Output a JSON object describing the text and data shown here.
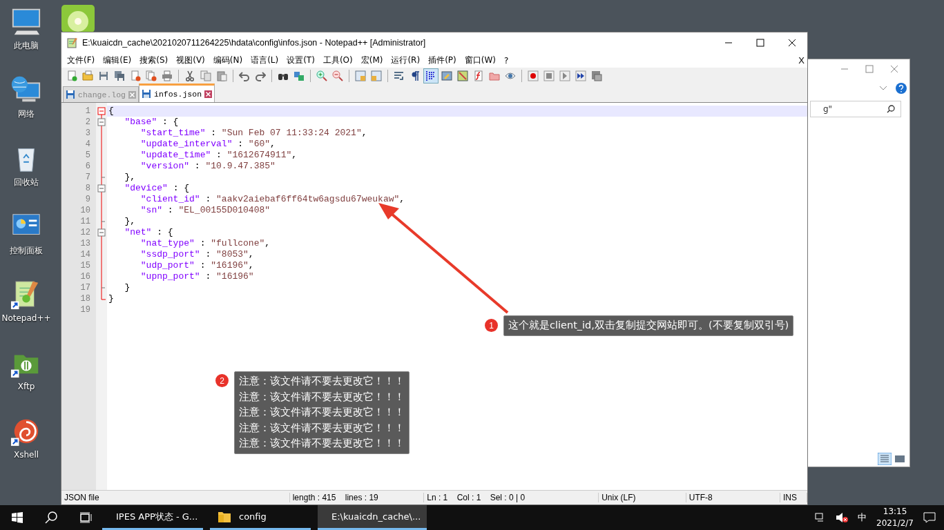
{
  "desktop_icons": [
    {
      "label": "此电脑",
      "kind": "computer",
      "shortcut": false
    },
    {
      "label": "网络",
      "kind": "network",
      "shortcut": false
    },
    {
      "label": "回收站",
      "kind": "recycle",
      "shortcut": false
    },
    {
      "label": "控制面板",
      "kind": "control",
      "shortcut": false
    },
    {
      "label": "Notepad++",
      "kind": "notepad",
      "shortcut": true
    },
    {
      "label": "Xftp",
      "kind": "xftp",
      "shortcut": true
    },
    {
      "label": "Xshell",
      "kind": "xshell",
      "shortcut": true
    }
  ],
  "background_window": {
    "search_value": "g\""
  },
  "window": {
    "title": "E:\\kuaicdn_cache\\2021020711264225\\hdata\\config\\infos.json - Notepad++ [Administrator]",
    "menu": [
      "文件(F)",
      "编辑(E)",
      "搜索(S)",
      "视图(V)",
      "编码(N)",
      "语言(L)",
      "设置(T)",
      "工具(O)",
      "宏(M)",
      "运行(R)",
      "插件(P)",
      "窗口(W)",
      "?"
    ],
    "menu_close": "X",
    "toolbar": [
      {
        "kind": "new",
        "selected": false
      },
      {
        "kind": "open",
        "selected": false
      },
      {
        "kind": "save",
        "selected": false
      },
      {
        "kind": "save-all",
        "selected": false
      },
      {
        "kind": "close",
        "selected": false
      },
      {
        "kind": "close-all",
        "selected": false
      },
      {
        "kind": "print",
        "selected": false
      },
      {
        "kind": "separator"
      },
      {
        "kind": "cut",
        "selected": false
      },
      {
        "kind": "copy",
        "selected": false
      },
      {
        "kind": "paste",
        "selected": false
      },
      {
        "kind": "separator"
      },
      {
        "kind": "undo",
        "selected": false
      },
      {
        "kind": "redo",
        "selected": false
      },
      {
        "kind": "separator"
      },
      {
        "kind": "find",
        "selected": false
      },
      {
        "kind": "replace",
        "selected": false
      },
      {
        "kind": "separator"
      },
      {
        "kind": "zoom-in",
        "selected": false
      },
      {
        "kind": "zoom-out",
        "selected": false
      },
      {
        "kind": "separator"
      },
      {
        "kind": "sync-v",
        "selected": false
      },
      {
        "kind": "sync-h",
        "selected": false
      },
      {
        "kind": "separator"
      },
      {
        "kind": "wrap",
        "selected": false
      },
      {
        "kind": "pilcrow",
        "selected": false
      },
      {
        "kind": "indent-guide",
        "selected": true
      },
      {
        "kind": "language",
        "selected": false
      },
      {
        "kind": "map",
        "selected": false
      },
      {
        "kind": "function",
        "selected": false
      },
      {
        "kind": "folder",
        "selected": false
      },
      {
        "kind": "eye",
        "selected": false
      },
      {
        "kind": "separator"
      },
      {
        "kind": "record",
        "selected": false
      },
      {
        "kind": "stop",
        "selected": false
      },
      {
        "kind": "play",
        "selected": false
      },
      {
        "kind": "play-multi",
        "selected": false
      },
      {
        "kind": "save-macro",
        "selected": false
      }
    ],
    "tabs": [
      {
        "label": "change.log",
        "selected": false
      },
      {
        "label": "infos.json",
        "selected": true
      }
    ],
    "lines": [
      {
        "number": "1",
        "text": "{",
        "current": true
      },
      {
        "number": "2",
        "text": "   \"base\" : {",
        "current": false
      },
      {
        "number": "3",
        "text": "      \"start_time\" : \"Sun Feb 07 11:33:24 2021\",",
        "current": false
      },
      {
        "number": "4",
        "text": "      \"update_interval\" : \"60\",",
        "current": false
      },
      {
        "number": "5",
        "text": "      \"update_time\" : \"1612674911\",",
        "current": false
      },
      {
        "number": "6",
        "text": "      \"version\" : \"10.9.47.385\"",
        "current": false
      },
      {
        "number": "7",
        "text": "   },",
        "current": false
      },
      {
        "number": "8",
        "text": "   \"device\" : {",
        "current": false
      },
      {
        "number": "9",
        "text": "      \"client_id\" : \"aakv2aiebaf6ff64tw6agsdu67weukaw\",",
        "current": false
      },
      {
        "number": "10",
        "text": "      \"sn\" : \"EL_00155D010408\"",
        "current": false
      },
      {
        "number": "11",
        "text": "   },",
        "current": false
      },
      {
        "number": "12",
        "text": "   \"net\" : {",
        "current": false
      },
      {
        "number": "13",
        "text": "      \"nat_type\" : \"fullcone\",",
        "current": false
      },
      {
        "number": "14",
        "text": "      \"ssdp_port\" : \"8053\",",
        "current": false
      },
      {
        "number": "15",
        "text": "      \"udp_port\" : \"16196\",",
        "current": false
      },
      {
        "number": "16",
        "text": "      \"upnp_port\" : \"16196\"",
        "current": false
      },
      {
        "number": "17",
        "text": "   }",
        "current": false
      },
      {
        "number": "18",
        "text": "}",
        "current": false
      },
      {
        "number": "19",
        "current": false
      }
    ],
    "status_bar": [
      "JSON file",
      "length : 415    lines : 19",
      "Ln : 1    Col : 1    Sel : 0 | 0",
      "Unix (LF)",
      "UTF-8",
      "INS"
    ]
  },
  "annotations": [
    {
      "number": "1",
      "lines": [
        "这个就是client_id,双击复制提交网站即可。(不要复制双引号)"
      ]
    },
    {
      "number": "2",
      "lines": [
        "注意：该文件请不要去更改它！！！",
        "注意：该文件请不要去更改它！！！",
        "注意：该文件请不要去更改它！！！",
        "注意：该文件请不要去更改它！！！",
        "注意：该文件请不要去更改它！！！"
      ]
    }
  ],
  "taskbar": {
    "apps": [
      {
        "label": "IPES APP状态 - G...",
        "kind": "chrome",
        "selected": false
      },
      {
        "label": "config",
        "kind": "folder",
        "selected": false
      },
      {
        "label": "E:\\kuaicdn_cache\\...",
        "kind": "notepad",
        "selected": true
      }
    ],
    "ime": "中",
    "time": "13:15",
    "date": "2021/2/7"
  }
}
